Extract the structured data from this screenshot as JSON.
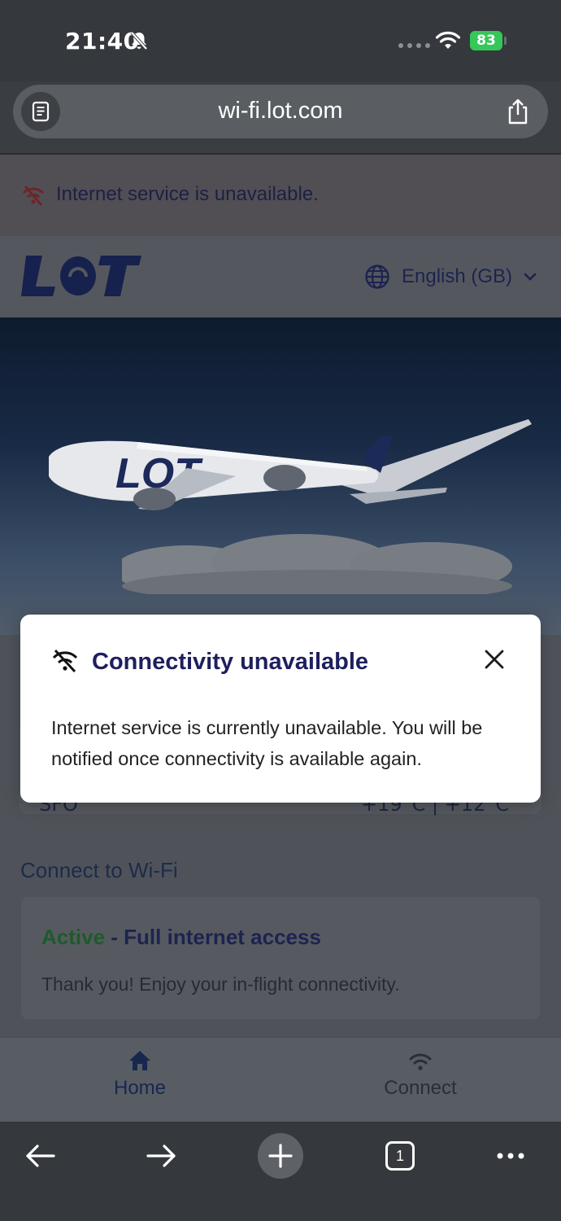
{
  "status_bar": {
    "time": "21:40",
    "battery_percent": "83",
    "icons": [
      "bell-slash-icon",
      "signal-dots-icon",
      "wifi-icon",
      "battery-charging-icon"
    ]
  },
  "browser": {
    "url": "wi-fi.lot.com",
    "icons": [
      "reader-icon",
      "share-icon"
    ]
  },
  "banner": {
    "text": "Internet service is unavailable.",
    "icon": "wifi-off-icon"
  },
  "header": {
    "logo": "LOT",
    "language": "English (GB)"
  },
  "hero": {
    "image": "LOT airplane flying above clouds"
  },
  "weather": {
    "city": "SFO",
    "temperatures": "+19°C | +12°C"
  },
  "connect": {
    "heading": "Connect to Wi-Fi",
    "status_active": "Active",
    "status_separator": " - ",
    "status_access": "Full internet access",
    "message": "Thank you! Enjoy your in-flight connectivity."
  },
  "nav": {
    "home_label": "Home",
    "connect_label": "Connect"
  },
  "modal": {
    "title": "Connectivity unavailable",
    "body": "Internet service is currently unavailable. You will be notified once connectivity is available again."
  },
  "toolbar": {
    "tab_count": "1"
  },
  "colors": {
    "modal_title": "#1d1f5e",
    "active_green": "#1e5a2a",
    "battery_green": "#35c759"
  }
}
